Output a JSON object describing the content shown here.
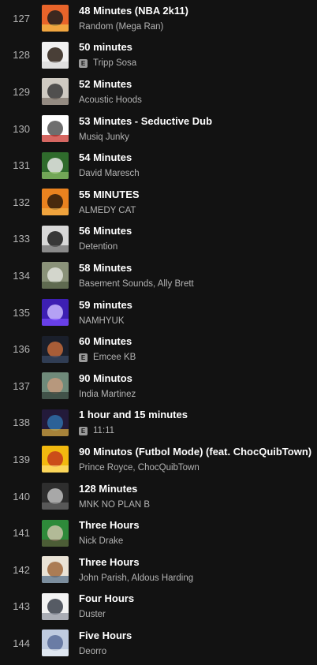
{
  "tracks": [
    {
      "index": "127",
      "title": "48 Minutes (NBA 2k11)",
      "artist": "Random (Mega Ran)",
      "explicit": false,
      "explicit_label": "",
      "art": {
        "bg": "#e8642a",
        "fg": "#1d1d1d",
        "accent": "#f5c24a"
      }
    },
    {
      "index": "128",
      "title": "50 minutes",
      "artist": "Tripp Sosa",
      "explicit": true,
      "explicit_label": "E",
      "art": {
        "bg": "#f1f1f1",
        "fg": "#2b2016",
        "accent": "#d9d9d9"
      }
    },
    {
      "index": "129",
      "title": "52 Minutes",
      "artist": "Acoustic Hoods",
      "explicit": false,
      "explicit_label": "",
      "art": {
        "bg": "#cfcac2",
        "fg": "#3a3a3a",
        "accent": "#7a7067"
      }
    },
    {
      "index": "130",
      "title": "53 Minutes - Seductive Dub",
      "artist": "Musiq Junky",
      "explicit": false,
      "explicit_label": "",
      "art": {
        "bg": "#ffffff",
        "fg": "#555555",
        "accent": "#c4261f"
      }
    },
    {
      "index": "131",
      "title": "54 Minutes",
      "artist": "David Maresch",
      "explicit": false,
      "explicit_label": "",
      "art": {
        "bg": "#2f6b2c",
        "fg": "#e6e6e6",
        "accent": "#8fbf6a"
      }
    },
    {
      "index": "132",
      "title": "55 MINUTES",
      "artist": "ALMEDY CAT",
      "explicit": false,
      "explicit_label": "",
      "art": {
        "bg": "#e9821f",
        "fg": "#2b1a0b",
        "accent": "#f2b14a"
      }
    },
    {
      "index": "133",
      "title": "56 Minutes",
      "artist": "Detention",
      "explicit": false,
      "explicit_label": "",
      "art": {
        "bg": "#d8d8d8",
        "fg": "#1b1b1b",
        "accent": "#6a6a6a"
      }
    },
    {
      "index": "134",
      "title": "58 Minutes",
      "artist": "Basement Sounds, Ally Brett",
      "explicit": false,
      "explicit_label": "",
      "art": {
        "bg": "#8a9279",
        "fg": "#dfe2da",
        "accent": "#4d5a3e"
      }
    },
    {
      "index": "135",
      "title": "59 minutes",
      "artist": "NAMHYUK",
      "explicit": false,
      "explicit_label": "",
      "art": {
        "bg": "#3d1fb3",
        "fg": "#c9b9ff",
        "accent": "#7a4dff"
      }
    },
    {
      "index": "136",
      "title": "60 Minutes",
      "artist": "Emcee KB",
      "explicit": true,
      "explicit_label": "E",
      "art": {
        "bg": "#1a1f2b",
        "fg": "#c2683a",
        "accent": "#3b4a66"
      }
    },
    {
      "index": "137",
      "title": "90 Minutos",
      "artist": "India Martinez",
      "explicit": false,
      "explicit_label": "",
      "art": {
        "bg": "#6f8a7a",
        "fg": "#c49a7e",
        "accent": "#2d3b34"
      }
    },
    {
      "index": "138",
      "title": "1 hour and 15 minutes",
      "artist": "11:11",
      "explicit": true,
      "explicit_label": "E",
      "art": {
        "bg": "#231a3a",
        "fg": "#2e6fa8",
        "accent": "#e0b03a"
      }
    },
    {
      "index": "139",
      "title": "90 Minutos (Futbol Mode) (feat. ChocQuibTown)",
      "artist": "Prince Royce, ChocQuibTown",
      "explicit": false,
      "explicit_label": "",
      "art": {
        "bg": "#f2b90f",
        "fg": "#c4391b",
        "accent": "#ffe27a"
      }
    },
    {
      "index": "140",
      "title": "128 Minutes",
      "artist": "MNK NO PLAN B",
      "explicit": false,
      "explicit_label": "",
      "art": {
        "bg": "#2e2e2e",
        "fg": "#bdbdbd",
        "accent": "#6b6b6b"
      }
    },
    {
      "index": "141",
      "title": "Three Hours",
      "artist": "Nick Drake",
      "explicit": false,
      "explicit_label": "",
      "art": {
        "bg": "#2e8a3a",
        "fg": "#c9c2a8",
        "accent": "#5a4a34"
      }
    },
    {
      "index": "142",
      "title": "Three Hours",
      "artist": "John Parish, Aldous Harding",
      "explicit": false,
      "explicit_label": "",
      "art": {
        "bg": "#e9e3d6",
        "fg": "#a06a3d",
        "accent": "#4d6a86"
      }
    },
    {
      "index": "143",
      "title": "Four Hours",
      "artist": "Duster",
      "explicit": false,
      "explicit_label": "",
      "art": {
        "bg": "#f3f3f3",
        "fg": "#3a3f4a",
        "accent": "#8a8f9a"
      }
    },
    {
      "index": "144",
      "title": "Five Hours",
      "artist": "Deorro",
      "explicit": false,
      "explicit_label": "",
      "art": {
        "bg": "#bfcbe0",
        "fg": "#5a6f9a",
        "accent": "#eef2f8"
      }
    }
  ]
}
